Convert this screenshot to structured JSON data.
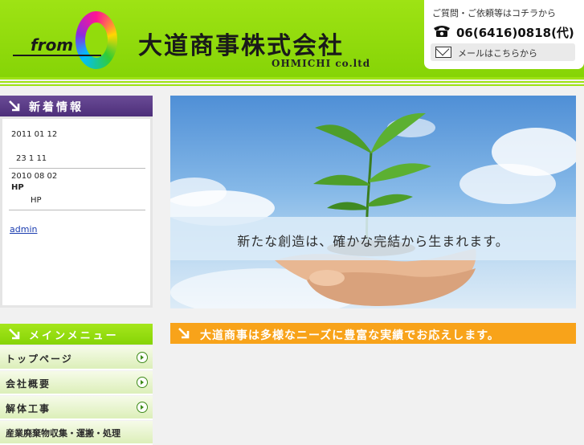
{
  "header": {
    "logo_text": "from",
    "company_name": "大道商事株式会社",
    "company_en": "OHMICHI co.ltd",
    "contact_prompt": "ご質問・ご依頼等はコチラから",
    "phone": "06(6416)0818(代)",
    "mail_label": "メールはこちらから"
  },
  "news": {
    "title": "新着情報",
    "items": [
      {
        "date": "2011 01 12",
        "line1": "",
        "line2": "23 1 11"
      },
      {
        "date": "2010 08 02",
        "line1": "HP",
        "line2": "HP"
      }
    ],
    "admin_link": "admin"
  },
  "menu": {
    "title": "メインメニュー",
    "items": [
      {
        "label": "トップページ"
      },
      {
        "label": "会社概要"
      },
      {
        "label": "解体工事"
      },
      {
        "label": "産業廃棄物収集・運搬・処理"
      }
    ]
  },
  "hero": {
    "caption": "新たな創造は、確かな完結から生まれます。"
  },
  "tagline": "大道商事は多様なニーズに豊富な実績でお応えします。",
  "colors": {
    "header_green": "#9ee314",
    "news_purple": "#5a3c86",
    "tagline_orange": "#f8a31a"
  }
}
